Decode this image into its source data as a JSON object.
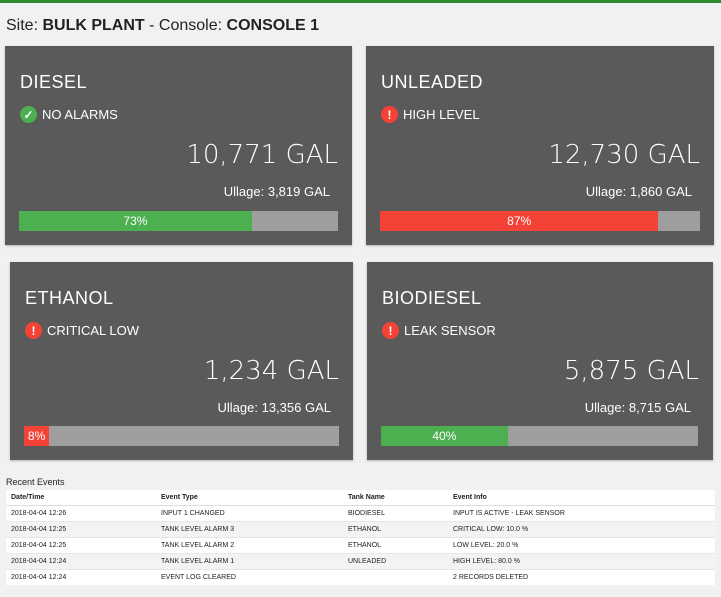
{
  "header": {
    "site_label": "Site:",
    "site": "BULK PLANT",
    "console_label": "Console:",
    "console": "CONSOLE 1"
  },
  "tanks": [
    {
      "name": "DIESEL",
      "status": "NO ALARMS",
      "status_icon": "check-circle-icon",
      "volume": "10,771 GAL",
      "ullage": "Ullage: 3,819 GAL",
      "percent_label": "73%",
      "fill_percent": 73,
      "fill_color": "#4caf50"
    },
    {
      "name": "UNLEADED",
      "status": "HIGH LEVEL",
      "status_icon": "alert-circle-icon",
      "volume": "12,730 GAL",
      "ullage": "Ullage: 1,860 GAL",
      "percent_label": "87%",
      "fill_percent": 87,
      "fill_color": "#f44336"
    },
    {
      "name": "ETHANOL",
      "status": "CRITICAL LOW",
      "status_icon": "alert-circle-icon",
      "volume": "1,234 GAL",
      "ullage": "Ullage: 13,356 GAL",
      "percent_label": "8%",
      "fill_percent": 8,
      "fill_color": "#f44336"
    },
    {
      "name": "BIODIESEL",
      "status": "LEAK SENSOR",
      "status_icon": "alert-circle-icon",
      "volume": "5,875 GAL",
      "ullage": "Ullage: 8,715 GAL",
      "percent_label": "40%",
      "fill_percent": 40,
      "fill_color": "#4caf50"
    }
  ],
  "events": {
    "title": "Recent Events",
    "columns": [
      "Date/Time",
      "Event Type",
      "Tank Name",
      "Event Info"
    ],
    "rows": [
      [
        "2018-04-04 12:26",
        "INPUT 1 CHANGED",
        "BIODIESEL",
        "INPUT IS ACTIVE - LEAK SENSOR"
      ],
      [
        "2018-04-04 12:25",
        "TANK LEVEL ALARM 3",
        "ETHANOL",
        "CRITICAL LOW: 10.0 %"
      ],
      [
        "2018-04-04 12:25",
        "TANK LEVEL ALARM 2",
        "ETHANOL",
        "LOW LEVEL: 20.0 %"
      ],
      [
        "2018-04-04 12:24",
        "TANK LEVEL ALARM 1",
        "UNLEADED",
        "HIGH LEVEL: 80.0 %"
      ],
      [
        "2018-04-04 12:24",
        "EVENT LOG CLEARED",
        "",
        "2 RECORDS DELETED"
      ]
    ]
  },
  "colors": {
    "header_border": "#2e8b2e",
    "card_bg": "#5a5a5a",
    "ok": "#4caf50",
    "alarm": "#f44336",
    "bar_bg": "#9e9e9e"
  }
}
